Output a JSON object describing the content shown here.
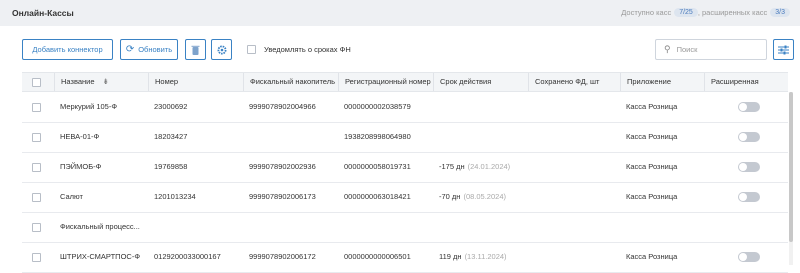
{
  "header": {
    "title": "Онлайн-Кассы",
    "available_label": "Доступно касс",
    "available_badge": "7/25",
    "extended_label": ", расширенных касс",
    "extended_badge": "3/3"
  },
  "toolbar": {
    "add_label": "Добавить коннектор",
    "refresh_label": "Обновить",
    "notify_label": "Уведомлять о сроках ФН",
    "search_placeholder": "Поиск"
  },
  "table": {
    "columns": [
      "Название",
      "Номер",
      "Фискальный накопитель",
      "Регистрационный номер",
      "Срок действия",
      "Сохранено ФД, шт",
      "Приложение",
      "Расширенная"
    ],
    "rows": [
      {
        "name": "Меркурий 105-Ф",
        "number": "23000692",
        "fn": "9999078902004966",
        "reg": "0000000002038579",
        "term": "",
        "term_date": "",
        "saved": "",
        "app": "Касса Розница"
      },
      {
        "name": "НЕВА-01-Ф",
        "number": "18203427",
        "fn": "",
        "reg": "1938208998064980",
        "term": "",
        "term_date": "",
        "saved": "",
        "app": "Касса Розница"
      },
      {
        "name": "ПЭЙМОБ-Ф",
        "number": "19769858",
        "fn": "9999078902002936",
        "reg": "0000000058019731",
        "term": "-175 дн",
        "term_date": "(24.01.2024)",
        "saved": "",
        "app": "Касса Розница"
      },
      {
        "name": "Салют",
        "number": "1201013234",
        "fn": "9999078902006173",
        "reg": "0000000063018421",
        "term": "-70 дн",
        "term_date": "(08.05.2024)",
        "saved": "",
        "app": "Касса Розница"
      },
      {
        "name": "Фискальный процесс...",
        "number": "",
        "fn": "",
        "reg": "",
        "term": "",
        "term_date": "",
        "saved": "",
        "app": ""
      },
      {
        "name": "ШТРИХ-СМАРТПОС-Ф",
        "number": "0129200033000167",
        "fn": "9999078902006172",
        "reg": "0000000000006501",
        "term": "119 дн",
        "term_date": "(13.11.2024)",
        "saved": "",
        "app": "Касса Розница"
      }
    ]
  }
}
